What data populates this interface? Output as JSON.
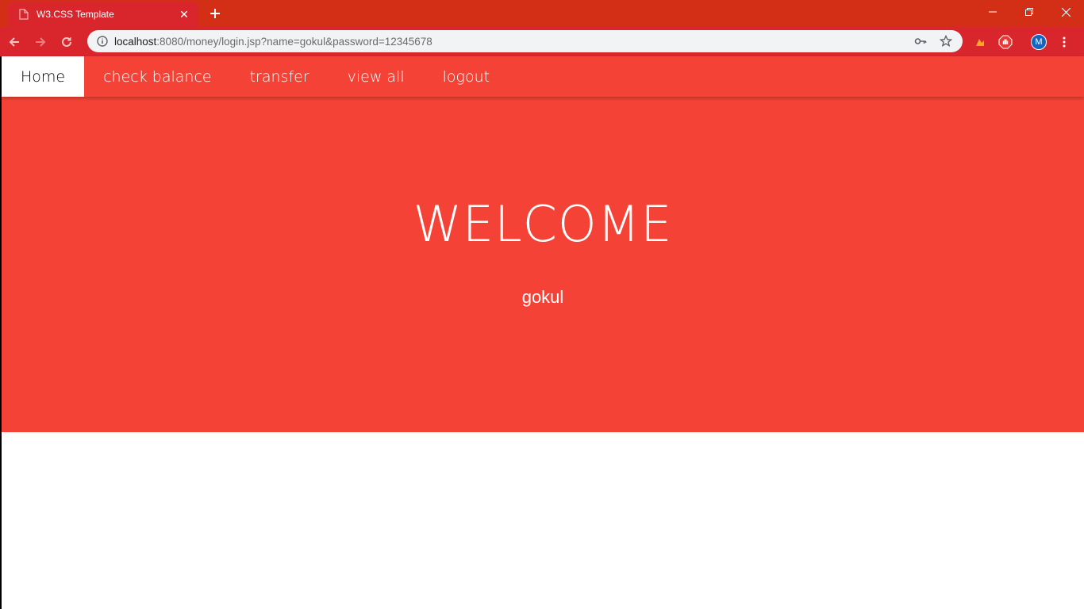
{
  "browser": {
    "tab_title": "W3.CSS Template",
    "url_host": "localhost",
    "url_rest": ":8080/money/login.jsp?name=gokul&password=12345678",
    "avatar_letter": "M",
    "chrome_color": "#d8262c"
  },
  "navbar": {
    "items": [
      {
        "label": "Home"
      },
      {
        "label": "check balance"
      },
      {
        "label": "transfer"
      },
      {
        "label": "view all"
      },
      {
        "label": "logout"
      }
    ],
    "accent": "#f44336"
  },
  "hero": {
    "title": "WELCOME",
    "username": "gokul"
  }
}
